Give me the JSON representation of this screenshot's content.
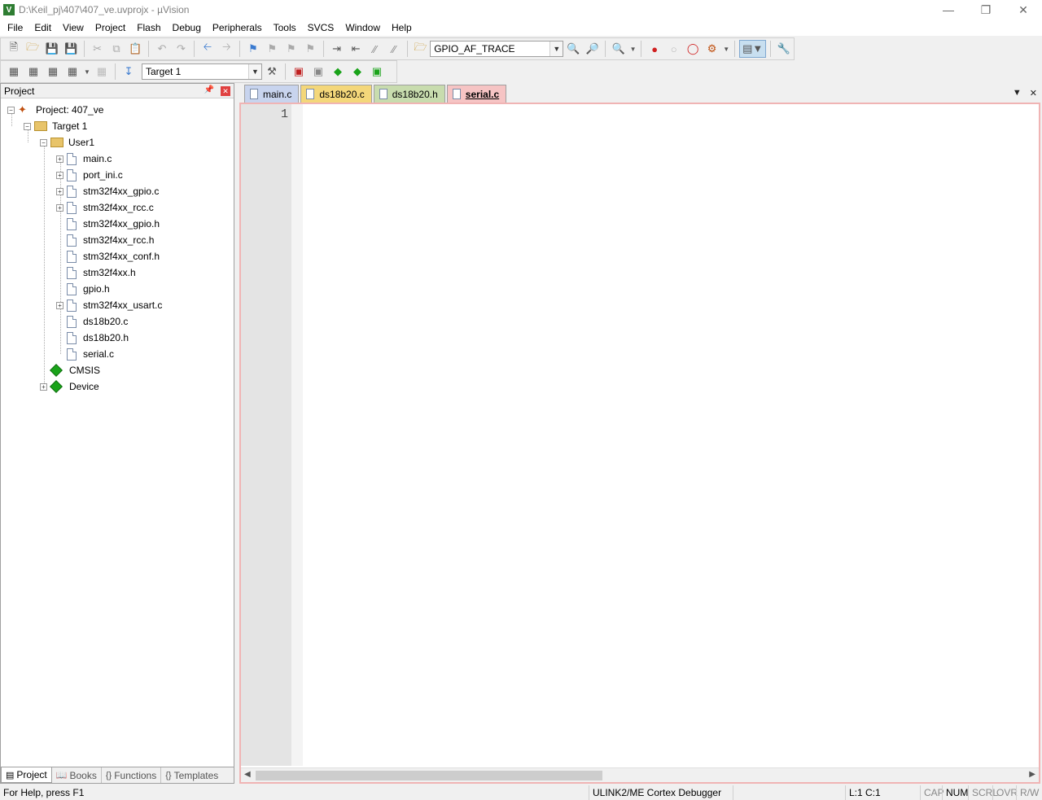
{
  "window": {
    "title": "D:\\Keil_pj\\407\\407_ve.uvprojx - µVision",
    "controls": [
      "minimize",
      "restore",
      "close"
    ]
  },
  "menu": [
    "File",
    "Edit",
    "View",
    "Project",
    "Flash",
    "Debug",
    "Peripherals",
    "Tools",
    "SVCS",
    "Window",
    "Help"
  ],
  "toolbar": {
    "find_combo": "GPIO_AF_TRACE",
    "target_combo": "Target 1"
  },
  "project_panel": {
    "title": "Project",
    "root": "Project: 407_ve",
    "target": "Target 1",
    "group": "User1",
    "files": [
      {
        "name": "main.c",
        "expandable": true
      },
      {
        "name": "port_ini.c",
        "expandable": true
      },
      {
        "name": "stm32f4xx_gpio.c",
        "expandable": true
      },
      {
        "name": "stm32f4xx_rcc.c",
        "expandable": true
      },
      {
        "name": "stm32f4xx_gpio.h",
        "expandable": false
      },
      {
        "name": "stm32f4xx_rcc.h",
        "expandable": false
      },
      {
        "name": "stm32f4xx_conf.h",
        "expandable": false
      },
      {
        "name": "stm32f4xx.h",
        "expandable": false
      },
      {
        "name": "gpio.h",
        "expandable": false
      },
      {
        "name": "stm32f4xx_usart.c",
        "expandable": true
      },
      {
        "name": "ds18b20.c",
        "expandable": false
      },
      {
        "name": "ds18b20.h",
        "expandable": false
      },
      {
        "name": "serial.c",
        "expandable": false
      }
    ],
    "components": [
      "CMSIS",
      "Device"
    ],
    "tabs": [
      "Project",
      "Books",
      "Functions",
      "Templates"
    ]
  },
  "editor": {
    "tabs": [
      "main.c",
      "ds18b20.c",
      "ds18b20.h",
      "serial.c"
    ],
    "active_tab": "serial.c",
    "line_number": "1"
  },
  "status": {
    "help": "For Help, press F1",
    "debugger": "ULINK2/ME Cortex Debugger",
    "position": "L:1 C:1",
    "cap": "CAP",
    "num": "NUM",
    "scrl": "SCRL",
    "ovr": "OVR",
    "rw": "R/W"
  }
}
